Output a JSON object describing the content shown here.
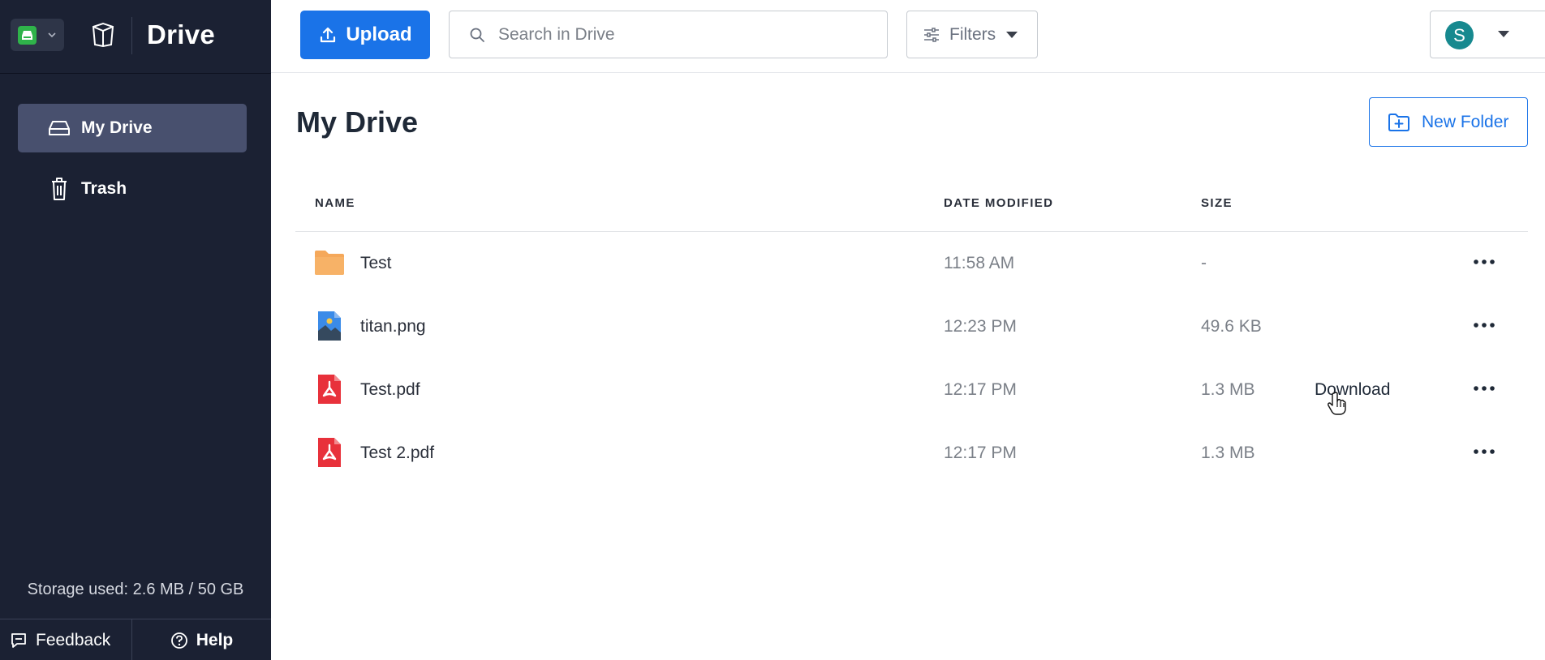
{
  "sidebar": {
    "brand_title": "Drive",
    "nav": [
      {
        "label": "My Drive",
        "icon": "drive-icon",
        "active": true
      },
      {
        "label": "Trash",
        "icon": "trash-icon",
        "active": false
      }
    ],
    "storage_text": "Storage used: 2.6 MB / 50 GB",
    "feedback_label": "Feedback",
    "help_label": "Help"
  },
  "topbar": {
    "upload_label": "Upload",
    "search_placeholder": "Search in Drive",
    "filters_label": "Filters",
    "avatar_initial": "S"
  },
  "main": {
    "title": "My Drive",
    "new_folder_label": "New Folder",
    "columns": {
      "name": "NAME",
      "date": "DATE MODIFIED",
      "size": "SIZE"
    },
    "files": [
      {
        "name": "Test",
        "type": "folder",
        "date": "11:58 AM",
        "size": "-"
      },
      {
        "name": "titan.png",
        "type": "image",
        "date": "12:23 PM",
        "size": "49.6 KB"
      },
      {
        "name": "Test.pdf",
        "type": "pdf",
        "date": "12:17 PM",
        "size": "1.3 MB",
        "hover_action": "Download"
      },
      {
        "name": "Test 2.pdf",
        "type": "pdf",
        "date": "12:17 PM",
        "size": "1.3 MB"
      }
    ]
  },
  "colors": {
    "sidebar_bg": "#1b2133",
    "active_nav": "#48506e",
    "accent": "#1a73e8",
    "folder": "#f5a85a",
    "pdf": "#e8313b",
    "avatar": "#17898f"
  }
}
